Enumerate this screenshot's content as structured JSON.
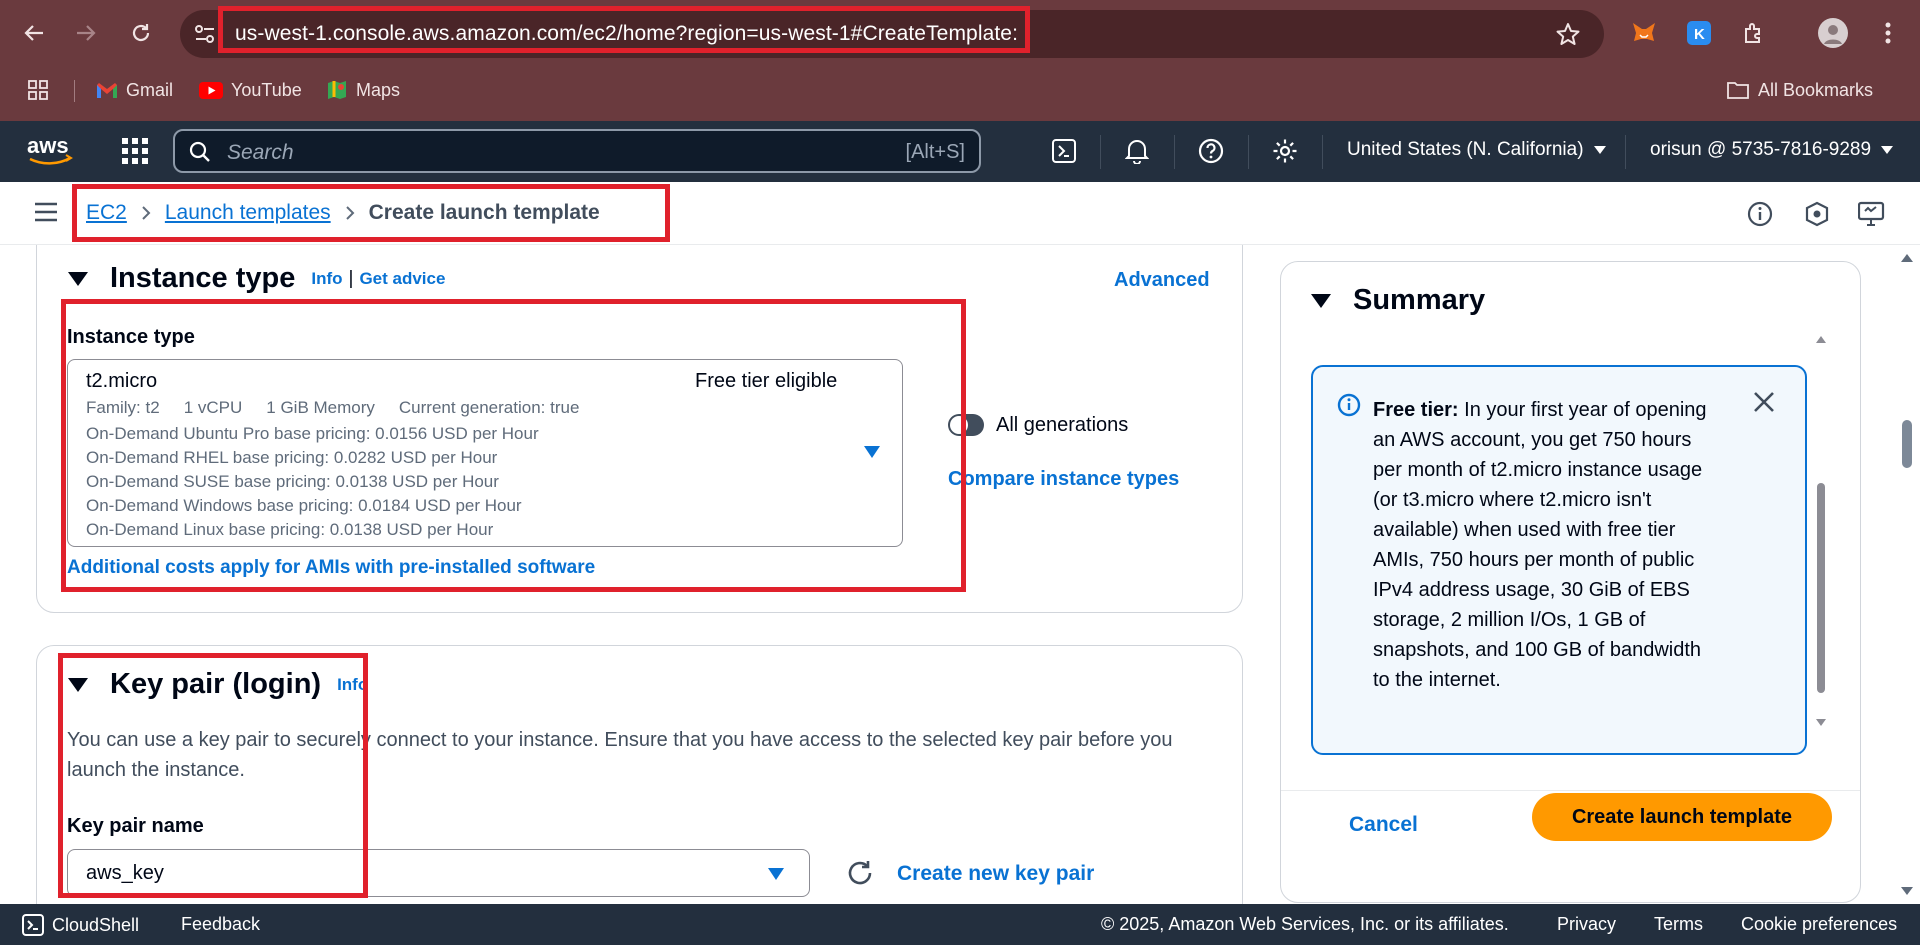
{
  "browser": {
    "url": "us-west-1.console.aws.amazon.com/ec2/home?region=us-west-1#CreateTemplate:",
    "bookmarks": [
      {
        "label": "Gmail",
        "icon": "gmail-icon"
      },
      {
        "label": "YouTube",
        "icon": "youtube-icon"
      },
      {
        "label": "Maps",
        "icon": "maps-icon"
      }
    ],
    "all_bookmarks": "All Bookmarks"
  },
  "aws": {
    "search_placeholder": "Search",
    "search_hint": "[Alt+S]",
    "region": "United States (N. California)",
    "account": "orisun @ 5735-7816-9289"
  },
  "breadcrumb": {
    "items": [
      "EC2",
      "Launch templates",
      "Create launch template"
    ]
  },
  "instance_type": {
    "title": "Instance type",
    "info": "Info",
    "separator": "|",
    "get_advice": "Get advice",
    "advanced": "Advanced",
    "field_label": "Instance type",
    "selected": "t2.micro",
    "free_tier": "Free tier eligible",
    "family": "Family: t2",
    "vcpu": "1 vCPU",
    "memory": "1 GiB Memory",
    "generation": "Current generation: true",
    "pricing": [
      "On-Demand Ubuntu Pro base pricing: 0.0156 USD per Hour",
      "On-Demand RHEL base pricing: 0.0282 USD per Hour",
      "On-Demand SUSE base pricing: 0.0138 USD per Hour",
      "On-Demand Windows base pricing: 0.0184 USD per Hour",
      "On-Demand Linux base pricing: 0.0138 USD per Hour"
    ],
    "all_generations": "All generations",
    "compare": "Compare instance types",
    "additional_costs": "Additional costs apply for AMIs with pre-installed software"
  },
  "key_pair": {
    "title": "Key pair (login)",
    "info": "Info",
    "description": "You can use a key pair to securely connect to your instance. Ensure that you have access to the selected key pair before you launch the instance.",
    "field_label": "Key pair name",
    "selected": "aws_key",
    "create_new": "Create new key pair"
  },
  "summary": {
    "title": "Summary",
    "free_tier_label": "Free tier:",
    "free_tier_text": "In your first year of opening an AWS account, you get 750 hours per month of t2.micro instance usage (or t3.micro where t2.micro isn't available) when used with free tier AMIs, 750 hours per month of public IPv4 address usage, 30 GiB of EBS storage, 2 million I/Os, 1 GB of snapshots, and 100 GB of bandwidth to the internet.",
    "cancel": "Cancel",
    "create": "Create launch template"
  },
  "footer": {
    "cloudshell": "CloudShell",
    "feedback": "Feedback",
    "copyright": "© 2025, Amazon Web Services, Inc. or its affiliates.",
    "privacy": "Privacy",
    "terms": "Terms",
    "cookies": "Cookie preferences"
  },
  "colors": {
    "browser_frame": "#6a3a3e",
    "aws_nav": "#232f3e",
    "link": "#0972d3",
    "primary_button": "#ff9900",
    "annotation": "#e0212c"
  }
}
